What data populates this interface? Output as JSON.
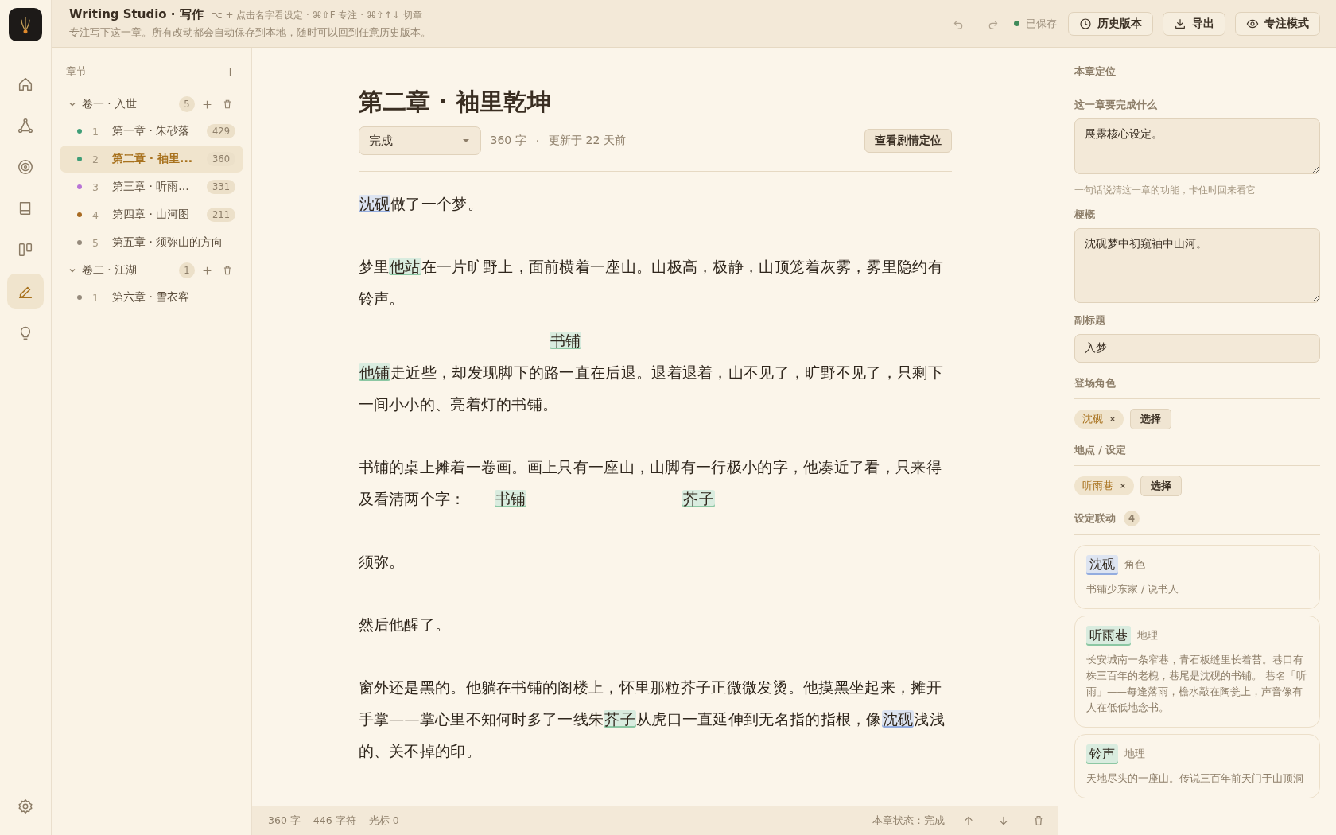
{
  "header": {
    "title": "Writing Studio · 写作",
    "shortcuts": "⌥ + 点击名字看设定 · ⌘⇧F 专注 · ⌘⇧↑↓ 切章",
    "subtitle": "专注写下这一章。所有改动都会自动保存到本地，随时可以回到任意历史版本。",
    "saved": "已保存",
    "buttons": [
      {
        "label": "历史版本"
      },
      {
        "label": "导出"
      },
      {
        "label": "专注模式"
      }
    ]
  },
  "rail": {
    "items": [
      {
        "selected": false
      },
      {
        "selected": false
      },
      {
        "selected": false
      },
      {
        "selected": false
      },
      {
        "selected": false
      },
      {
        "selected": true
      },
      {
        "selected": false
      }
    ]
  },
  "sidebar": {
    "heading": "章节",
    "volumes": [
      {
        "title": "卷一 · 入世",
        "count": "5",
        "expanded": true,
        "chapters": [
          {
            "num": "1",
            "title": "第一章 · 朱砂落",
            "count": "429",
            "color": "#3f9e78",
            "selected": false
          },
          {
            "num": "2",
            "title": "第二章 · 袖里...",
            "count": "360",
            "color": "#3f9e78",
            "selected": true
          },
          {
            "num": "3",
            "title": "第三章 · 听雨...",
            "count": "331",
            "color": "#b873d6",
            "selected": false
          },
          {
            "num": "4",
            "title": "第四章 · 山河图",
            "count": "211",
            "color": "#a86a22",
            "selected": false
          },
          {
            "num": "5",
            "title": "第五章 · 须弥山的方向",
            "color": "#958a7c",
            "selected": false
          }
        ]
      },
      {
        "title": "卷二 · 江湖",
        "count": "1",
        "expanded": true,
        "chapters": [
          {
            "num": "1",
            "title": "第六章 · 雪衣客",
            "color": "#958a7c",
            "selected": false
          }
        ]
      }
    ]
  },
  "editor": {
    "title": "第二章 · 袖里乾坤",
    "status": "完成",
    "word_count": "360 字",
    "separator": "·",
    "updated": "更新于 22 天前",
    "locate_button": "查看剧情定位",
    "paragraphs": [
      {
        "segments": [
          {
            "kind": "character",
            "text": "沈砚"
          },
          {
            "kind": "text",
            "text": "做了一个梦。"
          }
        ]
      },
      {
        "segments": [
          {
            "kind": "text",
            "text": "梦里"
          },
          {
            "kind": "place",
            "text": "他站"
          },
          {
            "kind": "text",
            "text": "在一片旷野上，面前横着一座山。山极高，极静，山顶笼着灰雾，雾里隐约有铃声。"
          }
        ]
      },
      {
        "above": {
          "kind": "place",
          "text": "书铺"
        },
        "segments": [
          {
            "kind": "place",
            "text": "他铺"
          },
          {
            "kind": "text",
            "text": "走近些，却发现脚下的路一直在后退。退着退着，山不见了，旷野不见了，只剩下一间小小的、亮着灯的书铺。"
          }
        ]
      },
      {
        "segments": [
          {
            "kind": "text",
            "text": "书铺的桌上摊着一卷画。画上只有一座山，山脚有一行极小的字，他凑近了看，只来得及看清两个字："
          },
          {
            "kind": "place",
            "text": "书铺",
            "detached": true
          },
          {
            "kind": "place",
            "text": "芥子",
            "detached": true
          }
        ]
      },
      {
        "segments": [
          {
            "kind": "text",
            "text": "须弥。"
          }
        ]
      },
      {
        "segments": [
          {
            "kind": "text",
            "text": "然后他醒了。"
          }
        ]
      },
      {
        "segments": [
          {
            "kind": "text",
            "text": "窗外还是黑的。他躺在书铺的阁楼上，怀里那粒芥子正微微发烫。他摸黑坐起来，摊开手掌——掌心里不知何时多了一线朱"
          },
          {
            "kind": "place",
            "text": "芥子"
          },
          {
            "kind": "text",
            "text": "从虎口一直延伸到无名指的指根，像"
          },
          {
            "kind": "character",
            "text": "沈砚"
          },
          {
            "kind": "text",
            "text": "浅浅的、关不掉的印。"
          }
        ]
      }
    ]
  },
  "status_bar": {
    "words": "360 字",
    "chars": "446 字符",
    "cursor": "光标 0",
    "chapter_status": "本章状态：完成"
  },
  "panel": {
    "heading": "本章定位",
    "goal_label": "这一章要完成什么",
    "goal": "展露核心设定。",
    "goal_hint": "一句话说清这一章的功能，卡住时回来看它",
    "synopsis_label": "梗概",
    "synopsis": "沈砚梦中初窥袖中山河。",
    "subtitle_label": "副标题",
    "subtitle": "入梦",
    "characters_label": "登场角色",
    "characters": [
      "沈砚"
    ],
    "pick": "选择",
    "places_label": "地点 / 设定",
    "places": [
      "听雨巷"
    ],
    "pick_place": "选择",
    "links_label": "设定联动",
    "links_count": "4",
    "links": [
      {
        "kind": "character",
        "name": "沈砚",
        "type": "角色",
        "desc": "书铺少东家 / 说书人"
      },
      {
        "kind": "place",
        "name": "听雨巷",
        "type": "地理",
        "desc": "长安城南一条窄巷，青石板缝里长着苔。巷口有株三百年的老槐，巷尾是沈砚的书铺。 巷名「听雨」——每逢落雨，檐水敲在陶瓮上，声音像有人在低低地念书。"
      },
      {
        "kind": "place",
        "name": "铃声",
        "type": "地理",
        "desc": "天地尽头的一座山。传说三百年前天门于山顶洞"
      }
    ]
  }
}
